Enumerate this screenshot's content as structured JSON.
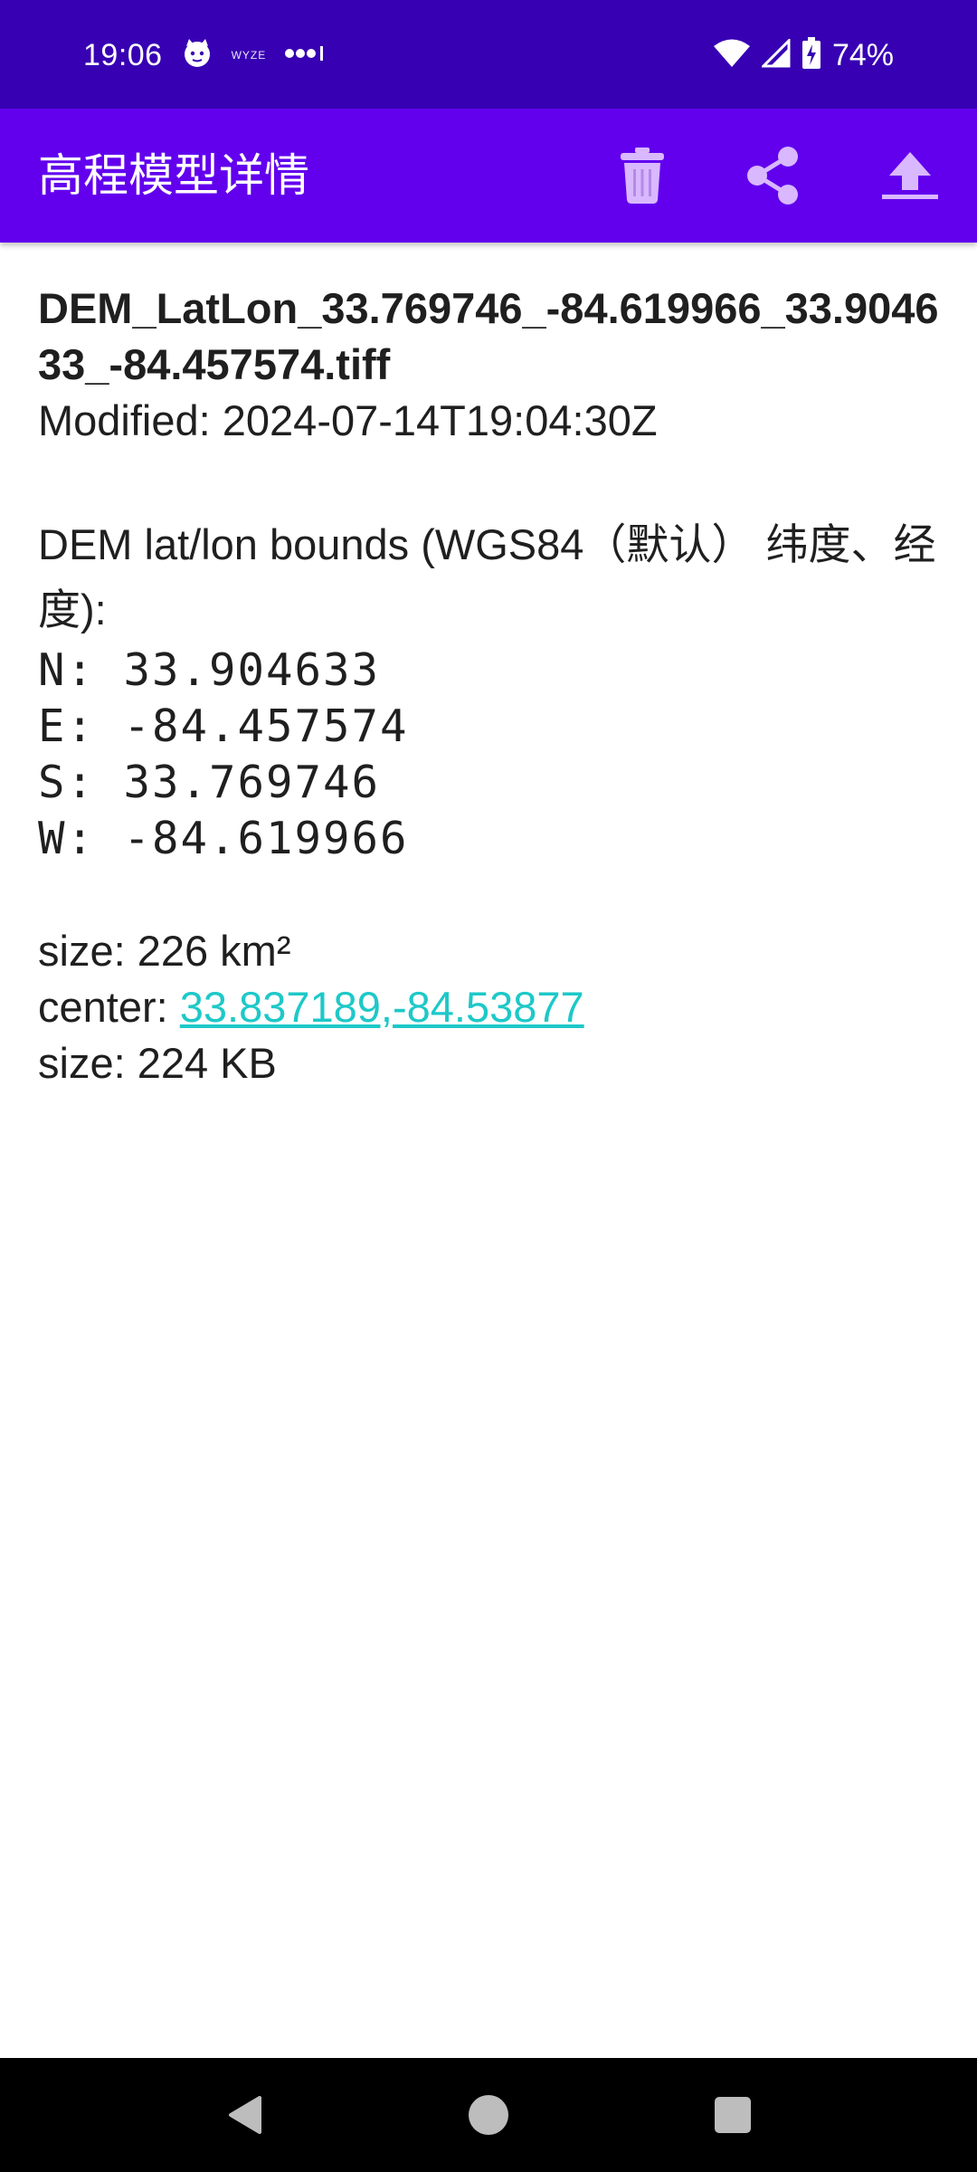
{
  "status_bar": {
    "time": "19:06",
    "wyze_text": "WYZE",
    "battery": "74%",
    "icons": [
      "cat-face-icon",
      "wyze-icon",
      "more-dots-icon",
      "wifi-icon",
      "cell-signal-icon",
      "battery-charging-icon"
    ]
  },
  "app_bar": {
    "title": "高程模型详情",
    "actions": [
      {
        "name": "delete",
        "icon": "trash-icon"
      },
      {
        "name": "share",
        "icon": "share-icon"
      },
      {
        "name": "upload",
        "icon": "upload-icon"
      }
    ]
  },
  "details": {
    "filename": "DEM_LatLon_33.769746_-84.619966_33.904633_-84.457574.tiff",
    "modified": "Modified: 2024-07-14T19:04:30Z",
    "bounds_label": "DEM lat/lon bounds (WGS84（默认） 纬度、经度):",
    "north": "N: 33.904633",
    "east": "E: -84.457574",
    "south": "S: 33.769746",
    "west": "W: -84.619966",
    "area_size": "size: 226 km²",
    "center_label": "center: ",
    "center_link": "33.837189,-84.53877",
    "file_size": "size: 224 KB"
  },
  "nav_bar": {
    "icons": [
      "back-icon",
      "home-icon",
      "recents-icon"
    ]
  },
  "colors": {
    "status_bar": "#3700b3",
    "app_bar": "#6200ee",
    "action_icon": "#d9b8ff",
    "link": "#1ec8c8",
    "nav_bar": "#000000"
  }
}
